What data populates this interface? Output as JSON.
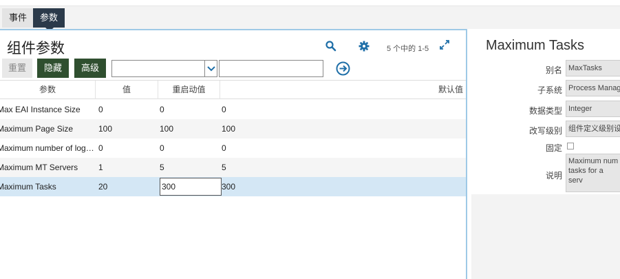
{
  "tabs": [
    {
      "label": "事件",
      "active": false
    },
    {
      "label": "参数",
      "active": true
    }
  ],
  "list": {
    "title": "组件参数",
    "record_count": "5 个中的 1-5",
    "buttons": {
      "reset": "重置",
      "hide": "隐藏",
      "advanced": "高级"
    },
    "query": {
      "field_value": "",
      "search_value": ""
    },
    "columns": [
      "参数",
      "值",
      "重启动值",
      "默认值"
    ],
    "rows": [
      {
        "param": "Max EAI Instance Size",
        "value": "0",
        "restart": "0",
        "default": "0"
      },
      {
        "param": "Maximum Page Size",
        "value": "100",
        "restart": "100",
        "default": "100"
      },
      {
        "param": "Maximum number of log fil...",
        "value": "0",
        "restart": "0",
        "default": "0"
      },
      {
        "param": "Maximum MT Servers",
        "value": "1",
        "restart": "5",
        "default": "5"
      },
      {
        "param": "Maximum Tasks",
        "value": "20",
        "restart": "300",
        "default": "300",
        "selected": true
      }
    ]
  },
  "detail": {
    "title": "Maximum Tasks",
    "fields": {
      "alias_label": "别名",
      "alias_value": "MaxTasks",
      "subsystem_label": "子系统",
      "subsystem_value": "Process Manag",
      "datatype_label": "数据类型",
      "datatype_value": "Integer",
      "override_label": "改写级别",
      "override_value": "组件定义级别设",
      "fixed_label": "固定",
      "desc_label": "说明",
      "desc_value": "Maximum num tasks for a serv"
    }
  },
  "colors": {
    "accent_dark": "#2f4f2f",
    "tab_active": "#2b3a4a",
    "selection": "#d4e7f5",
    "panel_border": "#9ec9e6",
    "icon_blue": "#1f6fa8"
  }
}
